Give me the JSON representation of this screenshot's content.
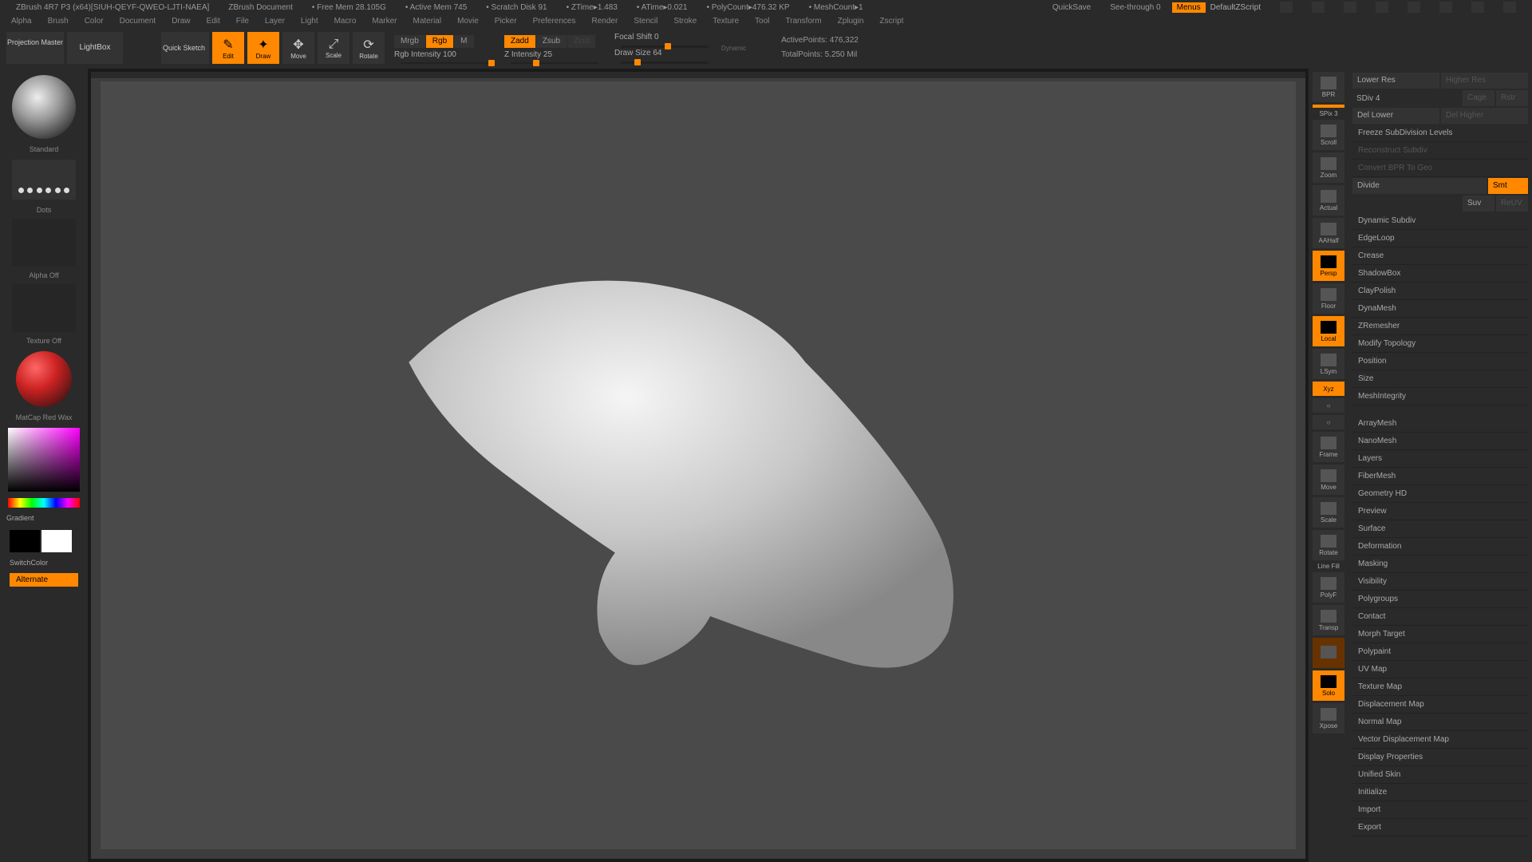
{
  "titlebar": {
    "app": "ZBrush 4R7 P3 (x64)[SIUH-QEYF-QWEO-LJTI-NAEA]",
    "doc": "ZBrush Document",
    "free_mem": "• Free Mem 28.105G",
    "active_mem": "• Active Mem 745",
    "scratch": "• Scratch Disk 91",
    "ztime": "• ZTime▸1.483",
    "atime": "• ATime▸0.021",
    "polycount": "• PolyCount▸476.32 KP",
    "meshcount": "• MeshCount▸1",
    "quicksave": "QuickSave",
    "seethrough": "See-through  0",
    "menus": "Menus",
    "script": "DefaultZScript"
  },
  "menubar": [
    "Alpha",
    "Brush",
    "Color",
    "Document",
    "Draw",
    "Edit",
    "File",
    "Layer",
    "Light",
    "Macro",
    "Marker",
    "Material",
    "Movie",
    "Picker",
    "Preferences",
    "Render",
    "Stencil",
    "Stroke",
    "Texture",
    "Tool",
    "Transform",
    "Zplugin",
    "Zscript"
  ],
  "toolbar": {
    "proj_master": "Projection Master",
    "lightbox": "LightBox",
    "quick_sketch": "Quick Sketch",
    "modes": {
      "edit": "Edit",
      "draw": "Draw",
      "move": "Move",
      "scale": "Scale",
      "rotate": "Rotate"
    },
    "mrgb": "Mrgb",
    "rgb": "Rgb",
    "m": "M",
    "rgb_intensity": "Rgb Intensity 100",
    "zadd": "Zadd",
    "zsub": "Zsub",
    "zcut": "Zcut",
    "z_intensity": "Z Intensity 25",
    "focal_shift": "Focal Shift 0",
    "draw_size": "Draw Size 64",
    "dynamic": "Dynamic",
    "active_points": "ActivePoints: 476,322",
    "total_points": "TotalPoints: 5.250 Mil"
  },
  "left": {
    "brush": "Standard",
    "stroke": "Dots",
    "alpha": "Alpha Off",
    "texture": "Texture Off",
    "material": "MatCap Red Wax",
    "gradient": "Gradient",
    "switchcolor": "SwitchColor",
    "alternate": "Alternate"
  },
  "right_tools": [
    "BPR",
    "SPix 3",
    "Scroll",
    "Zoom",
    "Actual",
    "AAHalf",
    "Persp",
    "",
    "Floor",
    "Local",
    "LSym",
    "Xyz",
    "",
    "",
    "Frame",
    "Move",
    "Scale",
    "Rotate",
    "Line Fill",
    "PolyF",
    "Transp",
    "",
    "Solo",
    "Xpose"
  ],
  "right_panel": {
    "lower_res": "Lower Res",
    "higher_res": "Higher Res",
    "sdiv": "SDiv 4",
    "cage": "Cage",
    "rstr": "Rstr",
    "del_lower": "Del Lower",
    "del_higher": "Del Higher",
    "freeze": "Freeze SubDivision Levels",
    "reconstruct": "Reconstruct Subdiv",
    "convert": "Convert BPR To Geo",
    "divide": "Divide",
    "smt": "Smt",
    "suv": "Suv",
    "reuv": "ReUV",
    "sections": [
      "Dynamic Subdiv",
      "EdgeLoop",
      "Crease",
      "ShadowBox",
      "ClayPolish",
      "DynaMesh",
      "ZRemesher",
      "Modify Topology",
      "Position",
      "Size",
      "MeshIntegrity"
    ],
    "sections2": [
      "ArrayMesh",
      "NanoMesh",
      "Layers",
      "FiberMesh",
      "Geometry HD",
      "Preview",
      "Surface",
      "Deformation",
      "Masking",
      "Visibility",
      "Polygroups",
      "Contact",
      "Morph Target",
      "Polypaint",
      "UV Map",
      "Texture Map",
      "Displacement Map",
      "Normal Map",
      "Vector Displacement Map",
      "Display Properties",
      "Unified Skin",
      "Initialize",
      "Import",
      "Export"
    ]
  }
}
